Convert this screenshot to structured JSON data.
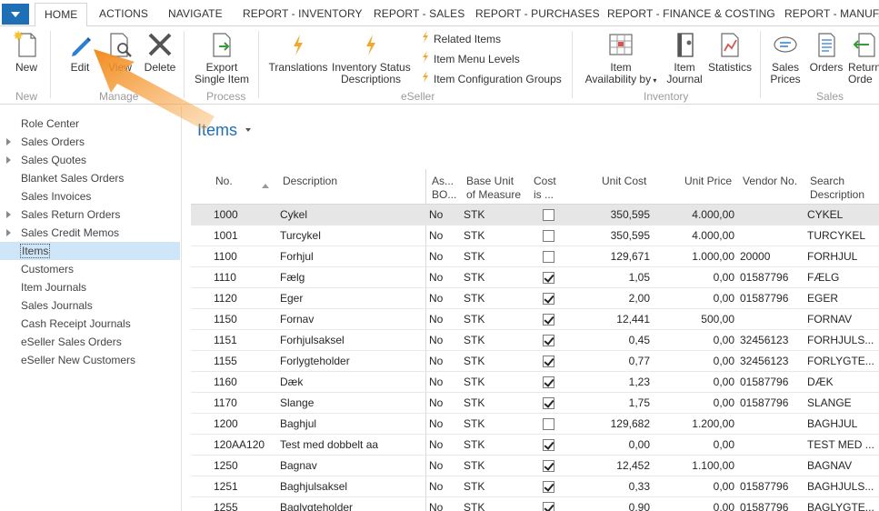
{
  "tabs": [
    "HOME",
    "ACTIONS",
    "NAVIGATE",
    "REPORT - INVENTORY",
    "REPORT - SALES",
    "REPORT - PURCHASES",
    "REPORT - FINANCE & COSTING",
    "REPORT - MANUFA"
  ],
  "ribbon": {
    "new": "New",
    "edit": "Edit",
    "view": "View",
    "delete": "Delete",
    "export_1": "Export",
    "export_2": "Single Item",
    "translations": "Translations",
    "inv_status_1": "Inventory Status",
    "inv_status_2": "Descriptions",
    "related_items": "Related Items",
    "item_menu_levels": "Item Menu Levels",
    "item_config_groups": "Item Configuration Groups",
    "item_avail_1": "Item",
    "item_avail_2": "Availability by",
    "item_journal_1": "Item",
    "item_journal_2": "Journal",
    "statistics": "Statistics",
    "sales_prices_1": "Sales",
    "sales_prices_2": "Prices",
    "orders": "Orders",
    "return_1": "Return",
    "return_2": "Orde",
    "groups": {
      "new": "New",
      "manage": "Manage",
      "process": "Process",
      "eseller": "eSeller",
      "inventory": "Inventory",
      "sales": "Sales"
    }
  },
  "nav": {
    "items": [
      {
        "label": "Role Center",
        "expandable": false
      },
      {
        "label": "Sales Orders",
        "expandable": true
      },
      {
        "label": "Sales Quotes",
        "expandable": true
      },
      {
        "label": "Blanket Sales Orders",
        "expandable": false
      },
      {
        "label": "Sales Invoices",
        "expandable": false
      },
      {
        "label": "Sales Return Orders",
        "expandable": true
      },
      {
        "label": "Sales Credit Memos",
        "expandable": true
      },
      {
        "label": "Items",
        "expandable": false,
        "selected": true
      },
      {
        "label": "Customers",
        "expandable": false
      },
      {
        "label": "Item Journals",
        "expandable": false
      },
      {
        "label": "Sales Journals",
        "expandable": false
      },
      {
        "label": "Cash Receipt Journals",
        "expandable": false
      },
      {
        "label": "eSeller Sales Orders",
        "expandable": false
      },
      {
        "label": "eSeller New Customers",
        "expandable": false
      }
    ]
  },
  "page": {
    "title": "Items"
  },
  "table": {
    "headers": {
      "no": "No.",
      "description": "Description",
      "asm_1": "As...",
      "asm_2": "BO...",
      "uom_1": "Base Unit",
      "uom_2": "of Measure",
      "cost_1": "Cost",
      "cost_2": "is ...",
      "unit_cost": "Unit Cost",
      "unit_price": "Unit Price",
      "vendor_no": "Vendor No.",
      "search_1": "Search",
      "search_2": "Description"
    },
    "rows": [
      {
        "no": "1000",
        "desc": "Cykel",
        "asm": "No",
        "uom": "STK",
        "cost_adj": false,
        "unit_cost": "350,595",
        "unit_price": "4.000,00",
        "vendor": "",
        "search": "CYKEL",
        "selected": true
      },
      {
        "no": "1001",
        "desc": "Turcykel",
        "asm": "No",
        "uom": "STK",
        "cost_adj": false,
        "unit_cost": "350,595",
        "unit_price": "4.000,00",
        "vendor": "",
        "search": "TURCYKEL"
      },
      {
        "no": "1100",
        "desc": "Forhjul",
        "asm": "No",
        "uom": "STK",
        "cost_adj": false,
        "unit_cost": "129,671",
        "unit_price": "1.000,00",
        "vendor": "20000",
        "search": "FORHJUL"
      },
      {
        "no": "1110",
        "desc": "Fælg",
        "asm": "No",
        "uom": "STK",
        "cost_adj": true,
        "unit_cost": "1,05",
        "unit_price": "0,00",
        "vendor": "01587796",
        "search": "FÆLG"
      },
      {
        "no": "1120",
        "desc": "Eger",
        "asm": "No",
        "uom": "STK",
        "cost_adj": true,
        "unit_cost": "2,00",
        "unit_price": "0,00",
        "vendor": "01587796",
        "search": "EGER"
      },
      {
        "no": "1150",
        "desc": "Fornav",
        "asm": "No",
        "uom": "STK",
        "cost_adj": true,
        "unit_cost": "12,441",
        "unit_price": "500,00",
        "vendor": "",
        "search": "FORNAV"
      },
      {
        "no": "1151",
        "desc": "Forhjulsaksel",
        "asm": "No",
        "uom": "STK",
        "cost_adj": true,
        "unit_cost": "0,45",
        "unit_price": "0,00",
        "vendor": "32456123",
        "search": "FORHJULS..."
      },
      {
        "no": "1155",
        "desc": "Forlygteholder",
        "asm": "No",
        "uom": "STK",
        "cost_adj": true,
        "unit_cost": "0,77",
        "unit_price": "0,00",
        "vendor": "32456123",
        "search": "FORLYGTE..."
      },
      {
        "no": "1160",
        "desc": "Dæk",
        "asm": "No",
        "uom": "STK",
        "cost_adj": true,
        "unit_cost": "1,23",
        "unit_price": "0,00",
        "vendor": "01587796",
        "search": "DÆK"
      },
      {
        "no": "1170",
        "desc": "Slange",
        "asm": "No",
        "uom": "STK",
        "cost_adj": true,
        "unit_cost": "1,75",
        "unit_price": "0,00",
        "vendor": "01587796",
        "search": "SLANGE"
      },
      {
        "no": "1200",
        "desc": "Baghjul",
        "asm": "No",
        "uom": "STK",
        "cost_adj": false,
        "unit_cost": "129,682",
        "unit_price": "1.200,00",
        "vendor": "",
        "search": "BAGHJUL"
      },
      {
        "no": "120AA120",
        "desc": "Test med dobbelt aa",
        "asm": "No",
        "uom": "STK",
        "cost_adj": true,
        "unit_cost": "0,00",
        "unit_price": "0,00",
        "vendor": "",
        "search": "TEST MED ..."
      },
      {
        "no": "1250",
        "desc": "Bagnav",
        "asm": "No",
        "uom": "STK",
        "cost_adj": true,
        "unit_cost": "12,452",
        "unit_price": "1.100,00",
        "vendor": "",
        "search": "BAGNAV"
      },
      {
        "no": "1251",
        "desc": "Baghjulsaksel",
        "asm": "No",
        "uom": "STK",
        "cost_adj": true,
        "unit_cost": "0,33",
        "unit_price": "0,00",
        "vendor": "01587796",
        "search": "BAGHJULS..."
      },
      {
        "no": "1255",
        "desc": "Baglygteholder",
        "asm": "No",
        "uom": "STK",
        "cost_adj": true,
        "unit_cost": "0,90",
        "unit_price": "0,00",
        "vendor": "01587796",
        "search": "BAGLYGTE..."
      }
    ]
  },
  "colors": {
    "accent": "#1f6fb7",
    "selected_nav": "#cfe6f8",
    "selected_row": "#e6e6e6",
    "arrow": "#f28b1e"
  }
}
